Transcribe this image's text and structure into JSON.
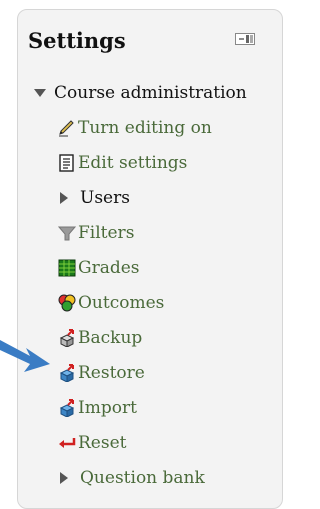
{
  "block": {
    "title": "Settings",
    "dock_icon": "dock-block-icon"
  },
  "tree": {
    "section": {
      "label": "Course administration",
      "icon": "triangle-down-icon"
    },
    "items": [
      {
        "label": "Turn editing on",
        "icon": "edit-pencil-icon"
      },
      {
        "label": "Edit settings",
        "icon": "settings-document-icon"
      },
      {
        "label": "Users",
        "icon": "triangle-right-icon"
      },
      {
        "label": "Filters",
        "icon": "funnel-icon"
      },
      {
        "label": "Grades",
        "icon": "grades-icon"
      },
      {
        "label": "Outcomes",
        "icon": "outcomes-icon"
      },
      {
        "label": "Backup",
        "icon": "backup-icon"
      },
      {
        "label": "Restore",
        "icon": "restore-icon"
      },
      {
        "label": "Import",
        "icon": "import-icon"
      },
      {
        "label": "Reset",
        "icon": "reset-icon"
      },
      {
        "label": "Question bank",
        "icon": "triangle-right-icon"
      }
    ]
  },
  "colors": {
    "link": "#4a6a3a",
    "text": "#111111",
    "panel_bg": "#f3f3f3",
    "arrow": "#3a7cc4"
  }
}
